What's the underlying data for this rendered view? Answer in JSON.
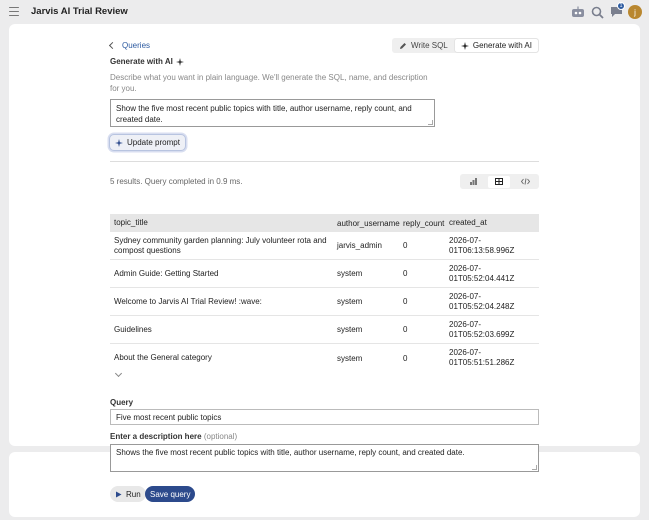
{
  "header": {
    "title": "Jarvis AI Trial Review",
    "avatar_letter": "j",
    "notification_count": "1",
    "icons": [
      "hamburger-icon",
      "robot-icon",
      "search-icon",
      "chat-icon"
    ]
  },
  "nav": {
    "back_label": "Queries"
  },
  "toolbar": {
    "write_sql_label": "Write SQL",
    "generate_label": "Generate with AI"
  },
  "generator": {
    "title": "Generate with AI",
    "description": "Describe what you want in plain language. We'll generate the SQL, name, and description for you.",
    "prompt_value": "Show the five most recent public topics with title, author username, reply count, and created date.",
    "update_button": "Update prompt"
  },
  "results": {
    "status": "5 results. Query completed in 0.9 ms.",
    "columns": [
      "topic_title",
      "author_username",
      "reply_count",
      "created_at"
    ],
    "rows": [
      {
        "topic_title": "Sydney community garden planning: July volunteer rota and compost questions",
        "author_username": "jarvis_admin",
        "reply_count": "0",
        "created_at": "2026-07-01T06:13:58.996Z"
      },
      {
        "topic_title": "Admin Guide: Getting Started",
        "author_username": "system",
        "reply_count": "0",
        "created_at": "2026-07-01T05:52:04.441Z"
      },
      {
        "topic_title": "Welcome to Jarvis AI Trial Review! :wave:",
        "author_username": "system",
        "reply_count": "0",
        "created_at": "2026-07-01T05:52:04.248Z"
      },
      {
        "topic_title": "Guidelines",
        "author_username": "system",
        "reply_count": "0",
        "created_at": "2026-07-01T05:52:03.699Z"
      },
      {
        "topic_title": "About the General category",
        "author_username": "system",
        "reply_count": "0",
        "created_at": "2026-07-01T05:51:51.286Z"
      }
    ]
  },
  "form": {
    "query_label": "Query",
    "query_value": "Five most recent public topics",
    "description_label": "Enter a description here",
    "description_optional": "(optional)",
    "description_value": "Shows the five most recent public topics with title, author username, reply count, and created date.",
    "run_label": "Run",
    "save_label": "Save query"
  },
  "colors": {
    "accent": "#2c4a8c",
    "link": "#2c5aa0",
    "avatar": "#b9872f"
  }
}
